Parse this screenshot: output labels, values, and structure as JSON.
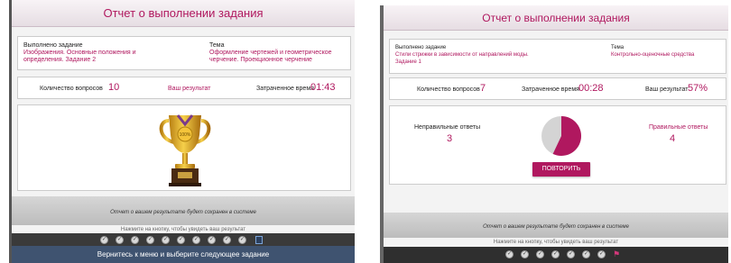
{
  "left": {
    "title": "Отчет о выполнении задания",
    "task_label": "Выполнено задание",
    "task_value": "Изображения. Основные положения и определения. Задание 2",
    "topic_label": "Тема",
    "topic_value": "Оформление чертежей и геометрическое черчение. Проекционное черчение",
    "questions_label": "Количество вопросов",
    "questions_value": "10",
    "result_label": "Ваш результат",
    "time_label": "Затраченное время",
    "time_value": "01:43",
    "trophy_text": "100%",
    "saved_notice": "Отчет о вашем результате будет сохранен в системе",
    "click_hint": "Нажмите на кнопку, чтобы увидеть ваш результат",
    "question_icons": [
      "check-icon",
      "check-icon",
      "check-icon",
      "check-icon",
      "check-icon",
      "check-icon",
      "check-icon",
      "check-icon",
      "check-icon",
      "check-icon",
      "list-icon"
    ],
    "return_text": "Вернитесь к меню и выберите следующее задание"
  },
  "right": {
    "title": "Отчет о выполнении задания",
    "task_label": "Выполнено задание",
    "task_value": "Стили стрижки в зависимости от направлений моды. Задание 1",
    "topic_label": "Тема",
    "topic_value": "Контрольно-оценочные средства",
    "questions_label": "Количество вопросов",
    "questions_value": "7",
    "time_label": "Затраченное время",
    "time_value": "00:28",
    "result_label": "Ваш результат",
    "result_value": "57%",
    "wrong_label": "Неправильные ответы",
    "wrong_value": "3",
    "right_label": "Правильные ответы",
    "right_value": "4",
    "repeat_button": "ПОВТОРИТЬ",
    "saved_notice": "Отчет о вашем результате будет сохранен в системе",
    "click_hint": "Нажмите на кнопку, чтобы увидеть ваш результат",
    "question_icons": [
      "check-icon",
      "check-icon",
      "check-icon",
      "check-icon",
      "check-icon",
      "check-icon",
      "check-icon",
      "flag-icon"
    ]
  },
  "colors": {
    "accent": "#b0185f",
    "pie_gray": "#d4d4d4",
    "footer_blue": "#3f5370"
  },
  "pie": {
    "correct_fraction": 0.57
  }
}
